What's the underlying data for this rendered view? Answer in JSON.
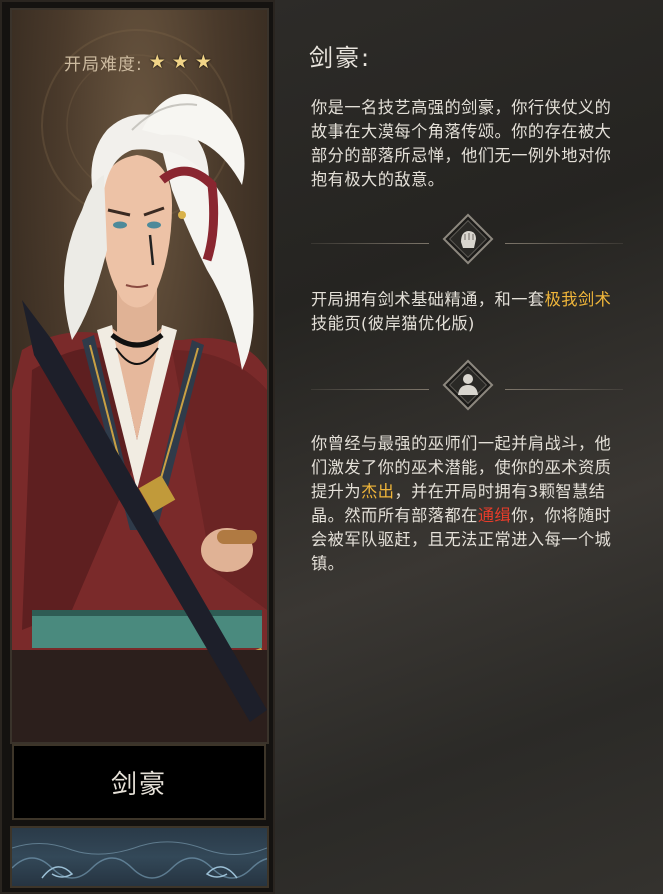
{
  "card": {
    "difficulty_label": "开局难度:",
    "stars": [
      "★",
      "★",
      "★"
    ],
    "name": "剑豪"
  },
  "panel": {
    "title": "剑豪:",
    "desc": "你是一名技艺高强的剑豪，你行侠仗义的故事在大漠每个角落传颂。你的存在被大部分的部落所忌惮，他们无一例外地对你抱有极大的敌意。",
    "skill": {
      "before": "开局拥有剑术基础精通，和一套",
      "highlight": "极我剑术",
      "after": "技能页(彼岸猫优化版)"
    },
    "trait": {
      "part1": "你曾经与最强的巫师们一起并肩战斗，他们激发了你的巫术潜能，使你的巫术资质提升为",
      "gold": "杰出",
      "part2": "，并在开局时拥有3颗智慧结晶。然而所有部落都在",
      "red": "通缉",
      "part3": "你，你将随时会被军队驱赶，且无法正常进入每一个城镇。"
    },
    "icons": [
      "fist-icon",
      "bust-icon"
    ],
    "colors": {
      "highlight_gold": "#f0b63a",
      "highlight_red": "#e83c2a"
    }
  }
}
